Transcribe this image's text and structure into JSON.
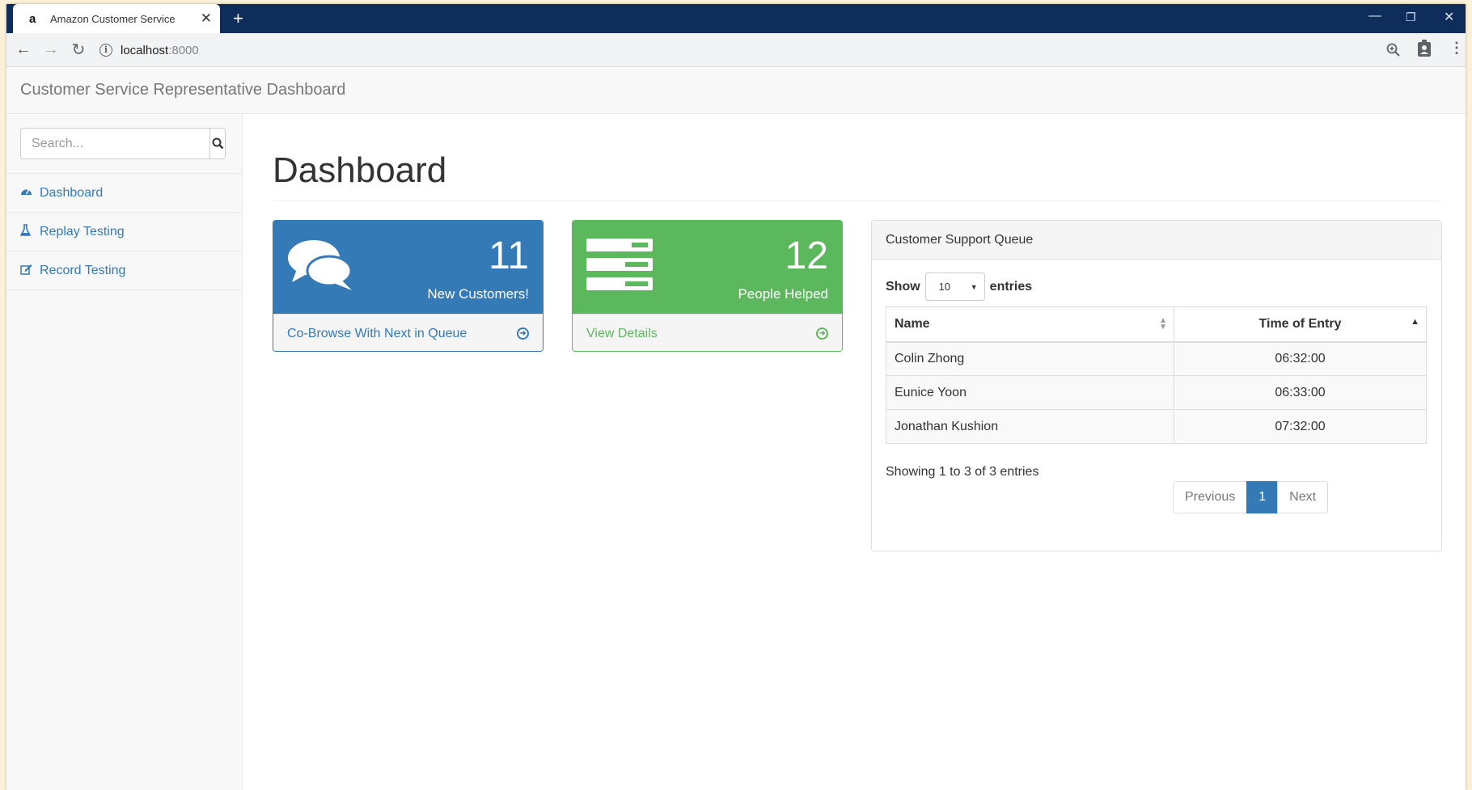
{
  "browser": {
    "tab_title": "Amazon Customer Service",
    "favicon": "a",
    "tab_close": "✕",
    "new_tab": "+",
    "url_host": "localhost",
    "url_port": ":8000"
  },
  "header": {
    "title": "Customer Service Representative Dashboard"
  },
  "sidebar": {
    "search_placeholder": "Search...",
    "items": [
      {
        "label": "Dashboard",
        "icon": "dashboard-icon"
      },
      {
        "label": "Replay Testing",
        "icon": "flask-icon"
      },
      {
        "label": "Record Testing",
        "icon": "edit-icon"
      }
    ]
  },
  "main": {
    "page_title": "Dashboard",
    "panels": [
      {
        "number": "11",
        "label": "New Customers!",
        "footer": "Co-Browse With Next in Queue",
        "color": "#337ab7",
        "icon": "comments-icon"
      },
      {
        "number": "12",
        "label": "People Helped",
        "footer": "View Details",
        "color": "#5cb85c",
        "icon": "tasks-icon"
      }
    ],
    "queue": {
      "title": "Customer Support Queue",
      "show_label": "Show",
      "page_size": "10",
      "entries_label": "entries",
      "columns": [
        "Name",
        "Time of Entry"
      ],
      "rows": [
        {
          "name": "Colin Zhong",
          "time": "06:32:00"
        },
        {
          "name": "Eunice Yoon",
          "time": "06:33:00"
        },
        {
          "name": "Jonathan Kushion",
          "time": "07:32:00"
        }
      ],
      "info": "Showing 1 to 3 of 3 entries",
      "pagination": {
        "previous": "Previous",
        "current": "1",
        "next": "Next"
      }
    }
  }
}
